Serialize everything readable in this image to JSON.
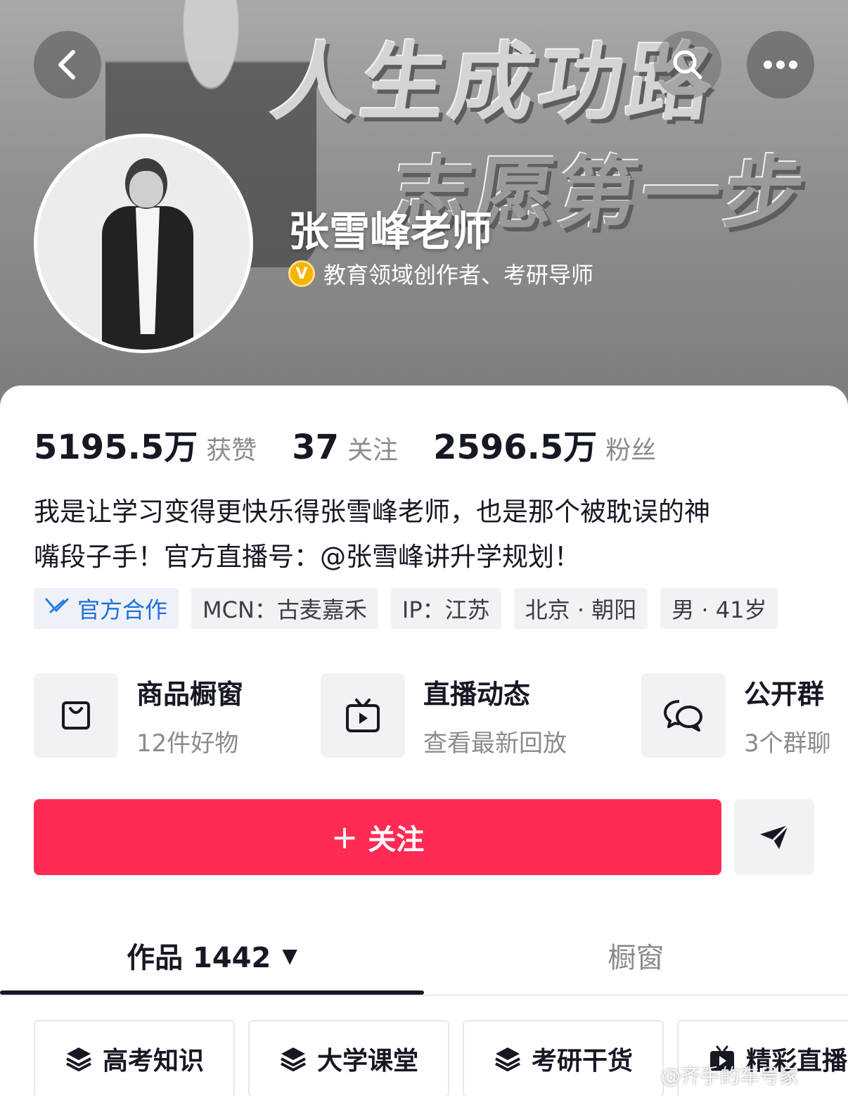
{
  "banner": {
    "line1": "人生成功路",
    "line2": "志愿第一步"
  },
  "profile": {
    "name": "张雪峰老师",
    "verified_badge": "V",
    "verified_text": "教育领域创作者、考研导师"
  },
  "stats": [
    {
      "value": "5195.5万",
      "label": "获赞"
    },
    {
      "value": "37",
      "label": "关注"
    },
    {
      "value": "2596.5万",
      "label": "粉丝"
    }
  ],
  "bio": {
    "line1": "我是让学习变得更快乐得张雪峰老师，也是那个被耽误的神",
    "line2": "嘴段子手！官方直播号：@张雪峰讲升学规划！"
  },
  "tags": {
    "official": "官方合作",
    "mcn": "MCN：古麦嘉禾",
    "ip": "IP：江苏",
    "location": "北京 · 朝阳",
    "gender_age": "男 · 41岁"
  },
  "features": [
    {
      "title": "商品橱窗",
      "sub": "12件好物",
      "icon": "shopping-bag-icon"
    },
    {
      "title": "直播动态",
      "sub": "查看最新回放",
      "icon": "tv-play-icon"
    },
    {
      "title": "公开群",
      "sub": "3个群聊",
      "icon": "chat-bubbles-icon"
    }
  ],
  "actions": {
    "follow_plus": "+",
    "follow_label": "关注"
  },
  "tabs": {
    "works_label": "作品 1442",
    "caret": "▼",
    "shop_label": "橱窗"
  },
  "collections": [
    "高考知识",
    "大学课堂",
    "考研干货",
    "精彩直播"
  ],
  "watermark": "@齐手的车号家",
  "colors": {
    "follow_button": "#fe2c55",
    "verified_badge": "#f5b400",
    "official_tag": "#1e6fd9"
  }
}
